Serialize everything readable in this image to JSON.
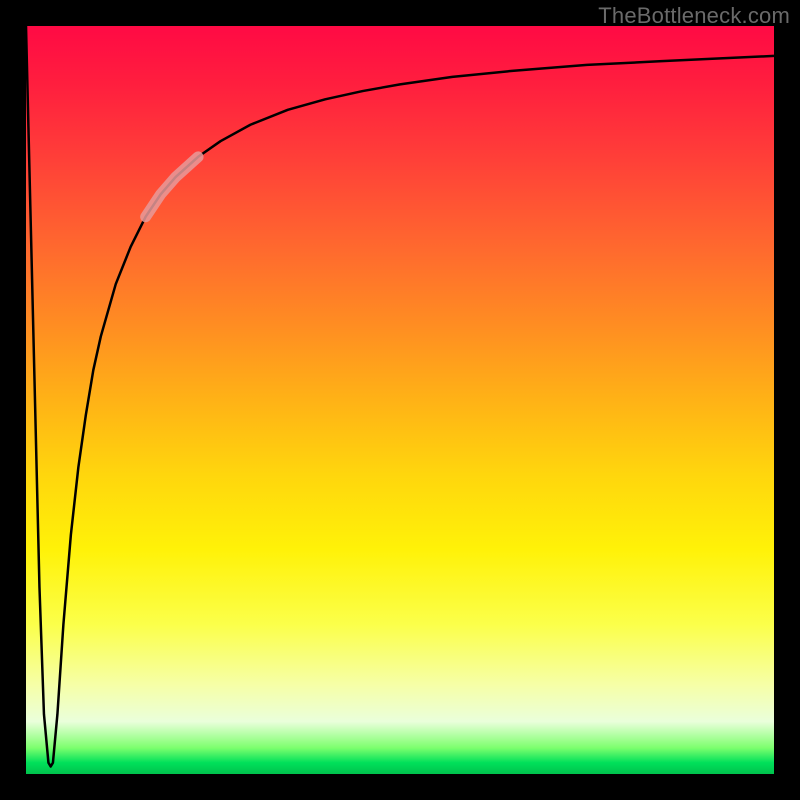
{
  "watermark": "TheBottleneck.com",
  "chart_data": {
    "type": "line",
    "title": "",
    "xlabel": "",
    "ylabel": "",
    "xlim": [
      0,
      100
    ],
    "ylim": [
      0,
      100
    ],
    "grid": false,
    "background_gradient": {
      "direction": "vertical",
      "stops": [
        {
          "pos": 0,
          "color": "#ff0a44"
        },
        {
          "pos": 18,
          "color": "#ff4038"
        },
        {
          "pos": 40,
          "color": "#ff8d22"
        },
        {
          "pos": 60,
          "color": "#ffd60d"
        },
        {
          "pos": 80,
          "color": "#fbff4a"
        },
        {
          "pos": 93,
          "color": "#eaffdb"
        },
        {
          "pos": 98,
          "color": "#00e05a"
        },
        {
          "pos": 100,
          "color": "#00c24d"
        }
      ]
    },
    "series": [
      {
        "name": "bottleneck-curve",
        "color": "#000000",
        "stroke_width": 2.5,
        "x": [
          0.0,
          0.6,
          1.2,
          1.8,
          2.4,
          3.0,
          3.3,
          3.6,
          4.2,
          5.0,
          6.0,
          7.0,
          8.0,
          9.0,
          10.0,
          12.0,
          14.0,
          16.0,
          18.0,
          20.0,
          23.0,
          26.0,
          30.0,
          35.0,
          40.0,
          45.0,
          50.0,
          57.0,
          65.0,
          75.0,
          85.0,
          100.0
        ],
        "y": [
          100.0,
          75.0,
          50.0,
          25.0,
          8.0,
          1.5,
          1.0,
          1.5,
          8.0,
          20.0,
          32.0,
          41.0,
          48.0,
          54.0,
          58.5,
          65.5,
          70.5,
          74.5,
          77.5,
          79.8,
          82.5,
          84.6,
          86.8,
          88.8,
          90.2,
          91.3,
          92.2,
          93.2,
          94.0,
          94.8,
          95.3,
          96.0
        ]
      },
      {
        "name": "highlight-segment",
        "color": "#e79a9a",
        "stroke_width": 11,
        "linecap": "round",
        "x": [
          16.0,
          18.0,
          20.0,
          23.0
        ],
        "y": [
          74.5,
          77.5,
          79.8,
          82.5
        ]
      }
    ]
  }
}
